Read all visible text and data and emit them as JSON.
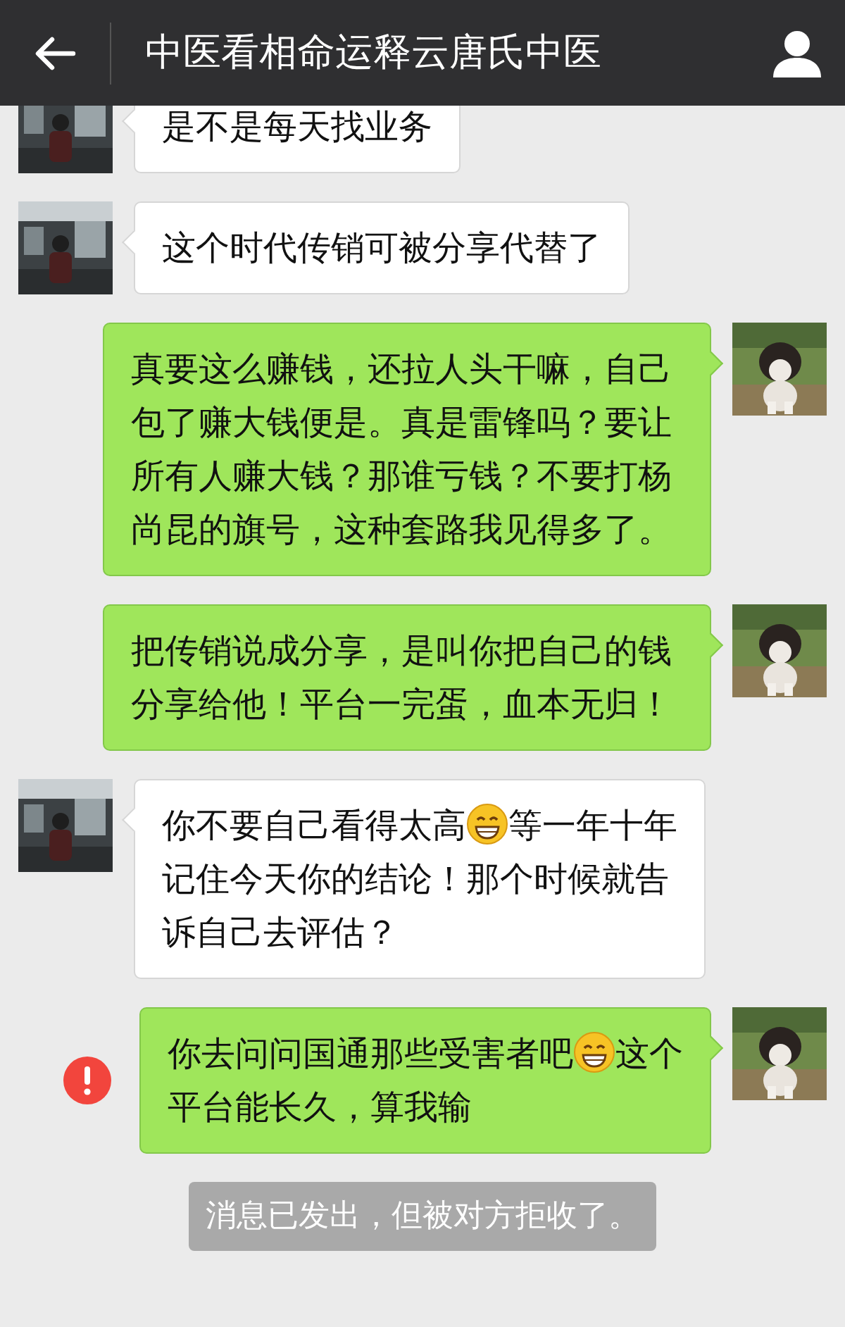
{
  "header": {
    "title": "中医看相命运释云唐氏中医"
  },
  "messages": [
    {
      "kind": "received",
      "failed": false,
      "segments": [
        {
          "kind": "text",
          "text": "是不是每天找业务"
        }
      ]
    },
    {
      "kind": "received",
      "failed": false,
      "segments": [
        {
          "kind": "text",
          "text": "这个时代传销可被分享代替了"
        }
      ]
    },
    {
      "kind": "sent",
      "failed": false,
      "segments": [
        {
          "kind": "text",
          "text": "真要这么赚钱，还拉人头干嘛，自己包了赚大钱便是。真是雷锋吗？要让所有人赚大钱？那谁亏钱？不要打杨尚昆的旗号，这种套路我见得多了。"
        }
      ]
    },
    {
      "kind": "sent",
      "failed": false,
      "segments": [
        {
          "kind": "text",
          "text": "把传销说成分享，是叫你把自己的钱分享给他！平台一完蛋，血本无归！"
        }
      ]
    },
    {
      "kind": "received",
      "failed": false,
      "segments": [
        {
          "kind": "text",
          "text": "你不要自己看得太高"
        },
        {
          "kind": "emoji"
        },
        {
          "kind": "text",
          "text": "等一年十年"
        },
        {
          "kind": "break"
        },
        {
          "kind": "text",
          "text": "记住今天你的结论！那个时候就告"
        },
        {
          "kind": "break"
        },
        {
          "kind": "text",
          "text": "诉自己去评估？"
        }
      ]
    },
    {
      "kind": "sent",
      "failed": true,
      "segments": [
        {
          "kind": "text",
          "text": "你去问问国通那些受害者吧"
        },
        {
          "kind": "emoji"
        },
        {
          "kind": "text",
          "text": "这个"
        },
        {
          "kind": "break"
        },
        {
          "kind": "text",
          "text": "平台能长久，算我输"
        }
      ]
    }
  ],
  "system_notice": "消息已发出，但被对方拒收了。"
}
